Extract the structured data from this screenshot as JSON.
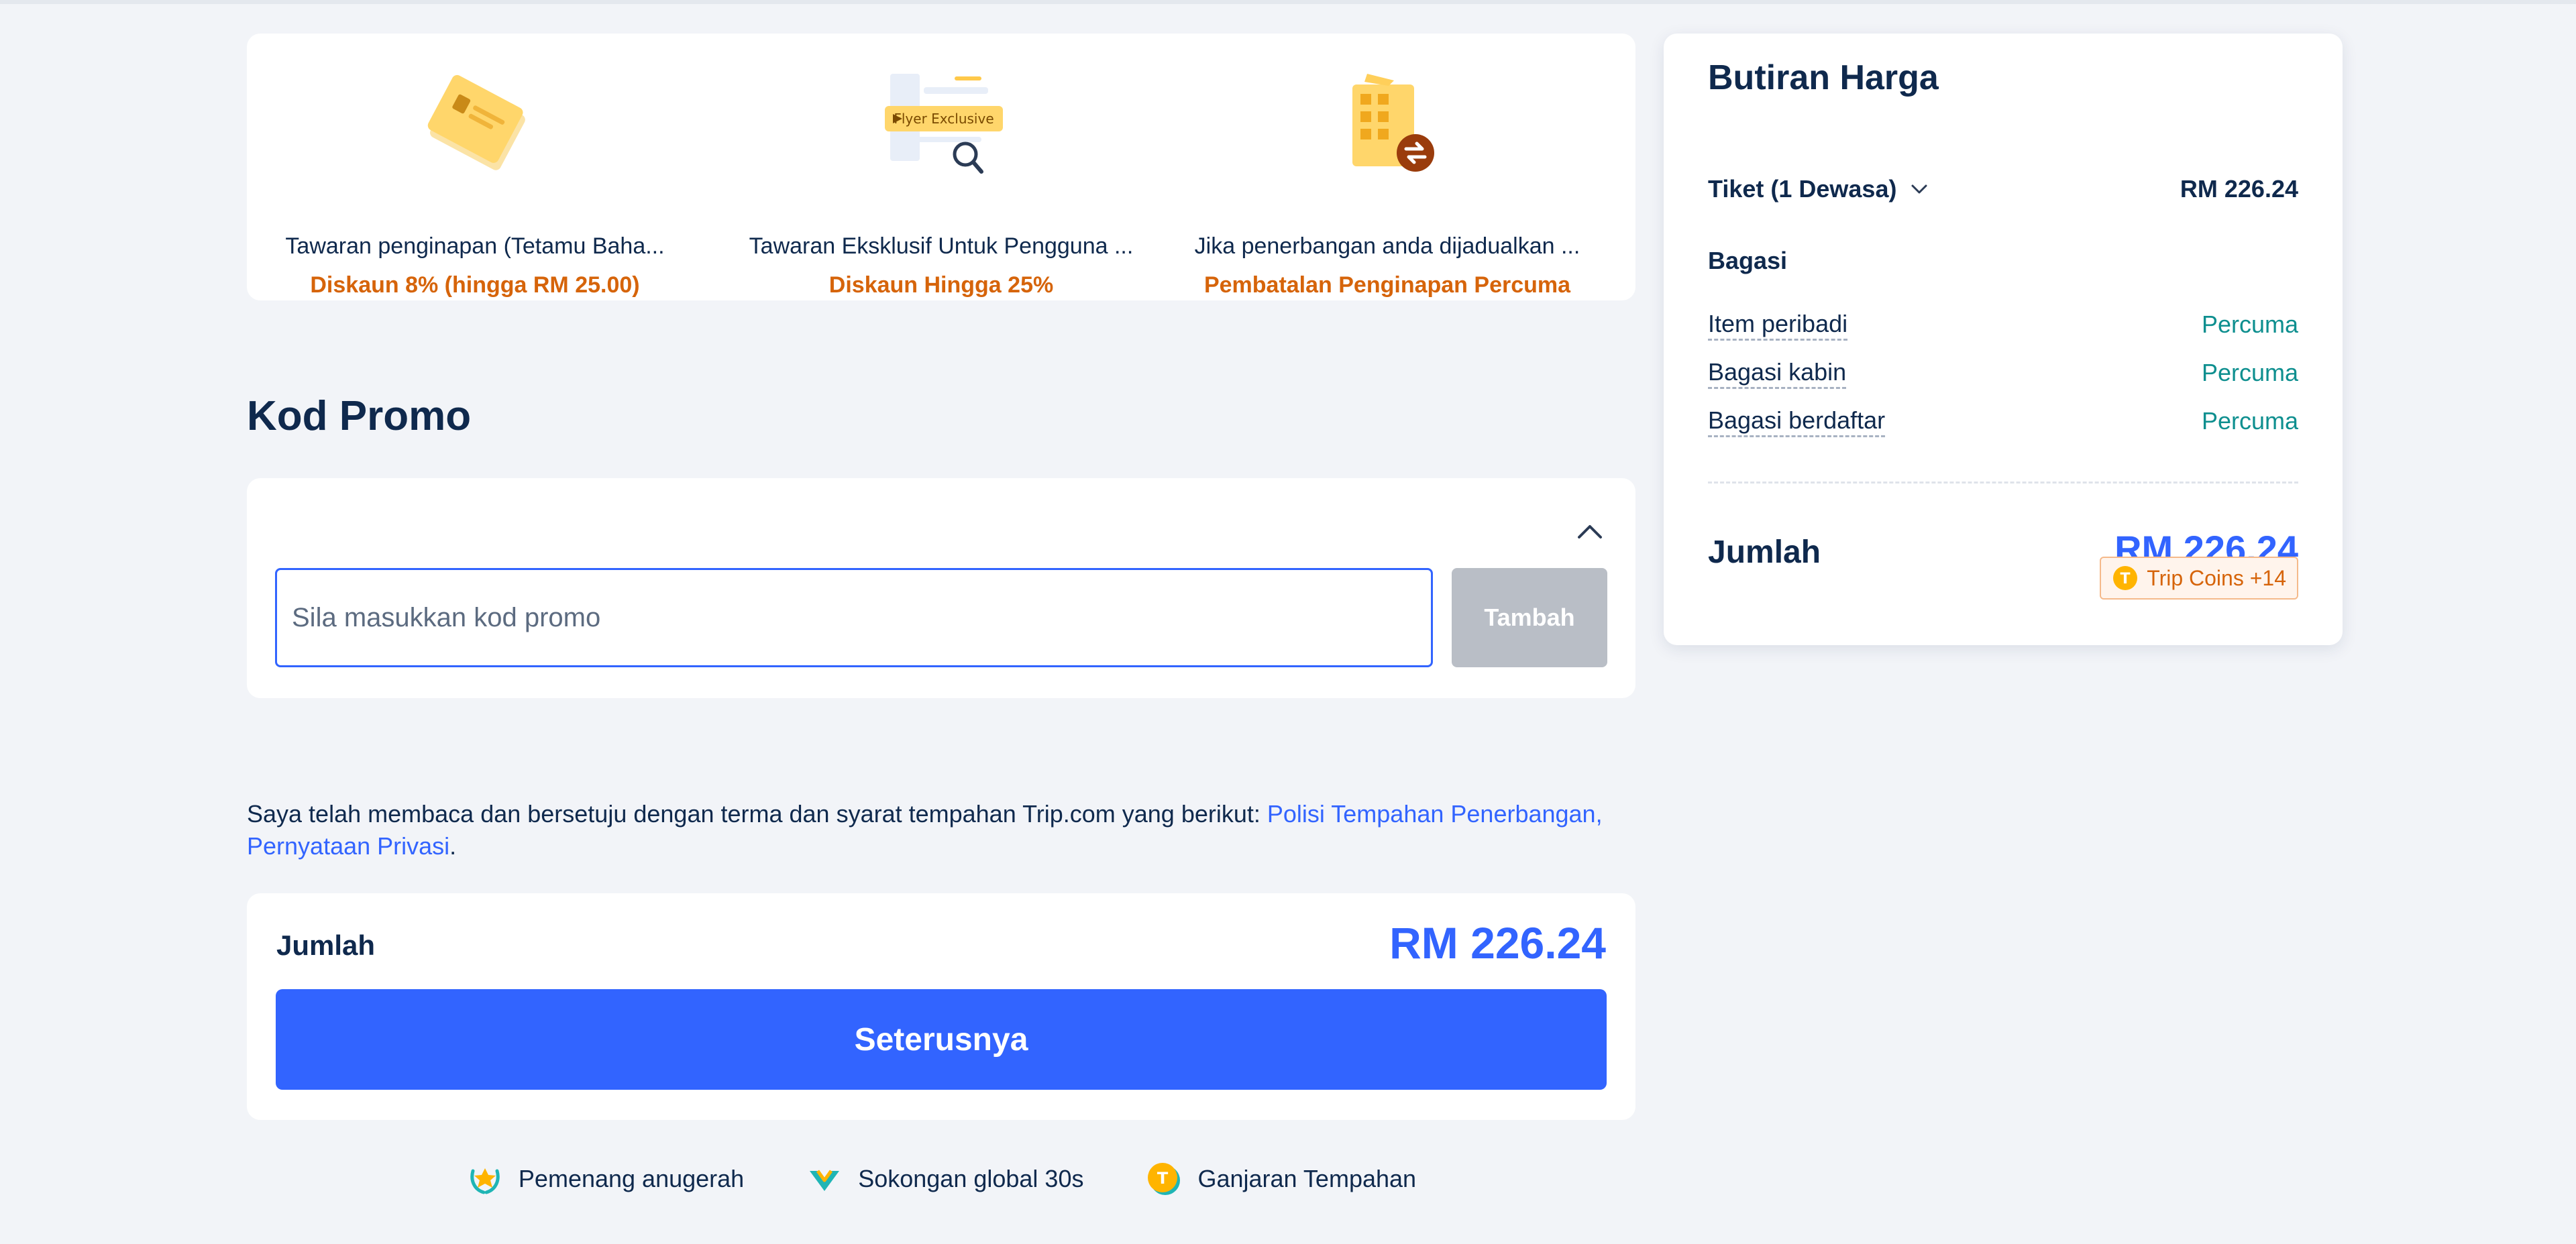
{
  "benefits": [
    {
      "icon": "hotel-voucher-icon",
      "description": "Tawaran penginapan (Tetamu Baha...",
      "offer": "Diskaun 8% (hingga RM 25.00)"
    },
    {
      "icon": "flyer-exclusive-icon",
      "badge": "Flyer Exclusive",
      "description": "Tawaran Eksklusif Untuk Pengguna ...",
      "offer": "Diskaun Hingga 25%"
    },
    {
      "icon": "hotel-cancellation-icon",
      "description": "Jika penerbangan anda dijadualkan ...",
      "offer": "Pembatalan Penginapan Percuma"
    }
  ],
  "promo": {
    "title": "Kod Promo",
    "placeholder": "Sila masukkan kod promo",
    "add_label": "Tambah"
  },
  "terms": {
    "text": "Saya telah membaca dan bersetuju dengan terma dan syarat tempahan Trip.com yang berikut: ",
    "link1": "Polisi Tempahan Penerbangan,",
    "link2": "Pernyataan Privasi",
    "end": "."
  },
  "total": {
    "label": "Jumlah",
    "value": "RM 226.24",
    "continue_label": "Seterusnya"
  },
  "trust": [
    {
      "icon": "award-laurel-icon",
      "label": "Pemenang anugerah"
    },
    {
      "icon": "global-support-icon",
      "label": "Sokongan global 30s"
    },
    {
      "icon": "trip-coin-icon",
      "label": "Ganjaran Tempahan"
    }
  ],
  "price_details": {
    "title": "Butiran Harga",
    "ticket_label": "Tiket (1 Dewasa)",
    "ticket_price": "RM 226.24",
    "baggage_heading": "Bagasi",
    "baggage": [
      {
        "name": "Item peribadi",
        "status": "Percuma"
      },
      {
        "name": "Bagasi kabin",
        "status": "Percuma"
      },
      {
        "name": "Bagasi berdaftar",
        "status": "Percuma"
      }
    ],
    "sum_label": "Jumlah",
    "sum_value": "RM 226.24",
    "coins": "Trip Coins +14"
  },
  "colors": {
    "primary": "#3264ff",
    "offer": "#d6640a",
    "free": "#0e8f8f",
    "disabled": "#b9bec6"
  }
}
